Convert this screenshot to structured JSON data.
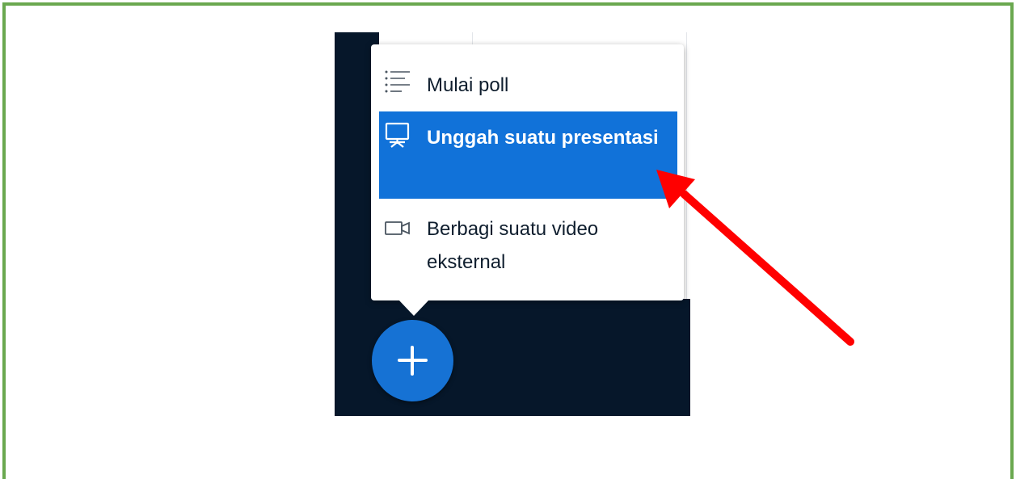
{
  "menu": {
    "items": [
      {
        "label": "Mulai poll",
        "icon": "list-icon"
      },
      {
        "label": "Unggah suatu presentasi",
        "icon": "presentation-icon",
        "selected": true
      },
      {
        "label": "Berbagi suatu video eksternal",
        "icon": "video-camera-icon"
      }
    ]
  },
  "colors": {
    "frame_border": "#6aa84f",
    "app_background": "#06172a",
    "highlight": "#1172d9",
    "action_button": "#1672d4",
    "annotation_arrow": "#ff0000"
  }
}
